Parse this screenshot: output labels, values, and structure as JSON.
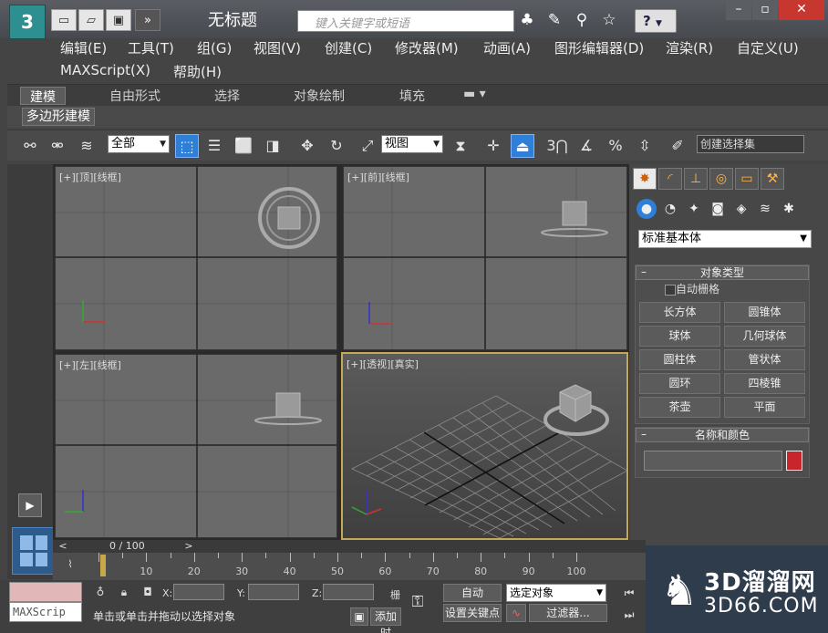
{
  "window": {
    "title": "无标题",
    "search_placeholder": "键入关键字或短语"
  },
  "menus_row1": [
    "编辑(E)",
    "工具(T)",
    "组(G)",
    "视图(V)",
    "创建(C)",
    "修改器(M)",
    "动画(A)",
    "图形编辑器(D)",
    "渲染(R)",
    "自定义(U)"
  ],
  "menus_row2": [
    "MAXScript(X)",
    "帮助(H)"
  ],
  "ribbon": {
    "tabs": [
      "建模",
      "自由形式",
      "选择",
      "对象绘制",
      "填充"
    ],
    "active_tab": "建模",
    "panel": "多边形建模"
  },
  "toolbar": {
    "filter": "全部",
    "ref_coord": "视图",
    "snap_value": "3",
    "named_selection": "创建选择集"
  },
  "viewports": {
    "top": "[+][顶][线框]",
    "front": "[+][前][线框]",
    "left": "[+][左][线框]",
    "persp": "[+][透视][真实]"
  },
  "command_panel": {
    "category": "标准基本体",
    "object_type_header": "对象类型",
    "autogrid": "自动栅格",
    "buttons": [
      "长方体",
      "圆锥体",
      "球体",
      "几何球体",
      "圆柱体",
      "管状体",
      "圆环",
      "四棱锥",
      "茶壶",
      "平面"
    ],
    "name_color_header": "名称和颜色",
    "object_color": "#c8252c"
  },
  "timeline": {
    "counter": "0 / 100",
    "ticks": [
      10,
      20,
      30,
      40,
      50,
      60,
      70,
      80,
      90,
      100
    ]
  },
  "status": {
    "script_listener": "MAXScrip",
    "prompt": "单击或单击并拖动以选择对象",
    "x_label": "X:",
    "y_label": "Y:",
    "z_label": "Z:",
    "grid_label": "栅",
    "add_time_tag": "添加时",
    "auto_key": "自动",
    "set_key": "设置关键点",
    "selection": "选定对象",
    "filters": "过滤器..."
  },
  "watermark": {
    "line1": "3D溜溜网",
    "line2": "3D66.COM"
  }
}
